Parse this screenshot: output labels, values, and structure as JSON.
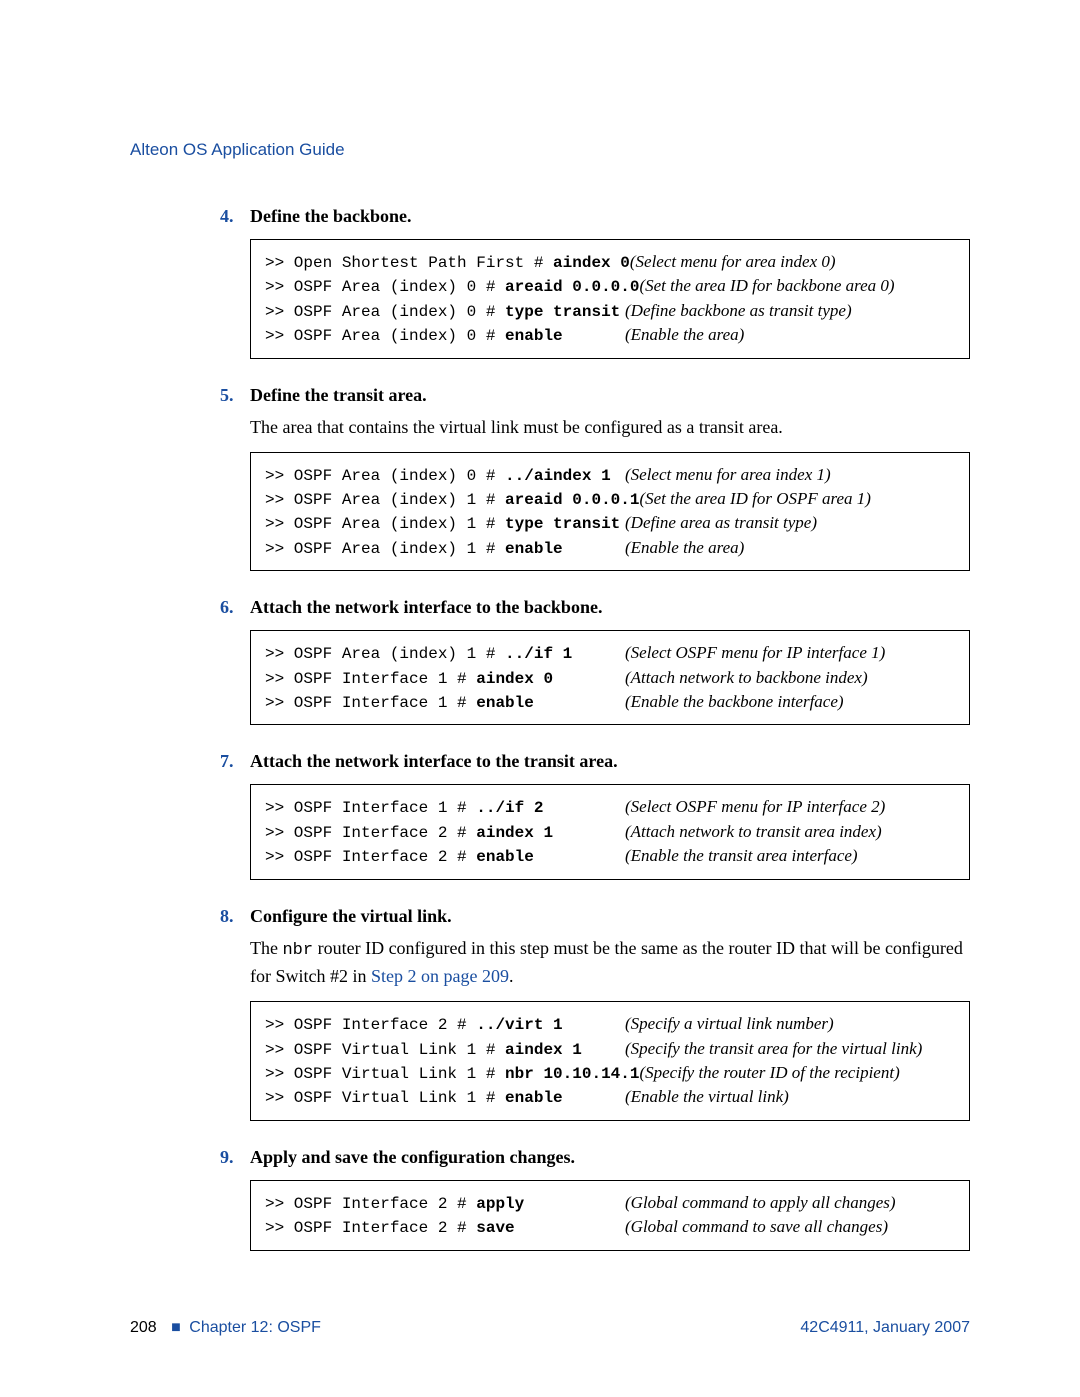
{
  "doc_title": "Alteon OS Application Guide",
  "steps": [
    {
      "num": "4.",
      "title": "Define the backbone.",
      "body_parts": [],
      "cmd": [
        {
          "prompt": ">> Open Shortest Path First # ",
          "input": "aindex 0",
          "note": "(Select menu for area index 0)"
        },
        {
          "prompt": ">> OSPF Area (index) 0 # ",
          "input": "areaid 0.0.0.0",
          "note": "(Set the area ID for backbone area 0)"
        },
        {
          "prompt": ">> OSPF Area (index) 0 # ",
          "input": "type transit",
          "note": "(Define backbone as transit type)"
        },
        {
          "prompt": ">> OSPF Area (index) 0 # ",
          "input": "enable",
          "note": "(Enable the area)"
        }
      ]
    },
    {
      "num": "5.",
      "title": "Define the transit area.",
      "body_parts": [
        {
          "kind": "text",
          "value": "The area that contains the virtual link must be configured as a transit area."
        }
      ],
      "cmd": [
        {
          "prompt": ">> OSPF Area (index) 0 # ",
          "input": "../aindex 1",
          "note": "(Select menu for area index 1)"
        },
        {
          "prompt": ">> OSPF Area (index) 1 # ",
          "input": "areaid 0.0.0.1",
          "note": "(Set the area ID for OSPF area 1)"
        },
        {
          "prompt": ">> OSPF Area (index) 1 # ",
          "input": "type transit",
          "note": "(Define area as transit type)"
        },
        {
          "prompt": ">> OSPF Area (index) 1 # ",
          "input": "enable",
          "note": "(Enable the area)"
        }
      ]
    },
    {
      "num": "6.",
      "title": "Attach the network interface to the backbone.",
      "body_parts": [],
      "cmd": [
        {
          "prompt": ">> OSPF Area (index) 1 # ",
          "input": "../if 1",
          "note": "(Select OSPF menu for IP interface 1)"
        },
        {
          "prompt": ">> OSPF Interface 1 # ",
          "input": "aindex 0",
          "note": "(Attach network to backbone index)"
        },
        {
          "prompt": ">> OSPF Interface 1 # ",
          "input": "enable",
          "note": "(Enable the backbone interface)"
        }
      ]
    },
    {
      "num": "7.",
      "title": "Attach the network interface to the transit area.",
      "body_parts": [],
      "cmd": [
        {
          "prompt": ">> OSPF Interface 1 # ",
          "input": "../if 2",
          "note": "(Select OSPF menu for IP interface 2)"
        },
        {
          "prompt": ">> OSPF Interface 2 # ",
          "input": "aindex 1",
          "note": "(Attach network to transit area index)"
        },
        {
          "prompt": ">> OSPF Interface 2 # ",
          "input": "enable",
          "note": "(Enable the transit area interface)"
        }
      ]
    },
    {
      "num": "8.",
      "title": "Configure the virtual link.",
      "body_parts": [
        {
          "kind": "text",
          "value": "The "
        },
        {
          "kind": "code",
          "value": "nbr"
        },
        {
          "kind": "text",
          "value": " router ID configured in this step must be the same as the router ID that will be configured for Switch #2 in "
        },
        {
          "kind": "link",
          "value": "Step 2 on page 209"
        },
        {
          "kind": "text",
          "value": "."
        }
      ],
      "cmd": [
        {
          "prompt": ">> OSPF Interface 2 # ",
          "input": "../virt 1",
          "note": "(Specify a virtual link number)"
        },
        {
          "prompt": ">> OSPF Virtual Link 1 # ",
          "input": "aindex 1",
          "note": "(Specify the transit area for the virtual link)"
        },
        {
          "prompt": ">> OSPF Virtual Link 1 # ",
          "input": "nbr 10.10.14.1",
          "note": "(Specify the router ID of the recipient)"
        },
        {
          "prompt": ">> OSPF Virtual Link 1 # ",
          "input": "enable",
          "note": "(Enable the virtual link)"
        }
      ]
    },
    {
      "num": "9.",
      "title": "Apply and save the configuration changes.",
      "body_parts": [],
      "cmd": [
        {
          "prompt": ">> OSPF Interface 2 # ",
          "input": "apply",
          "note": "(Global command to apply all changes)"
        },
        {
          "prompt": ">> OSPF Interface 2 # ",
          "input": "save",
          "note": "(Global command to save all changes)"
        }
      ]
    }
  ],
  "footer": {
    "page_no": "208",
    "bullet": "■",
    "chapter": "Chapter 12:  OSPF",
    "doc_code": "42C4911, January 2007"
  }
}
